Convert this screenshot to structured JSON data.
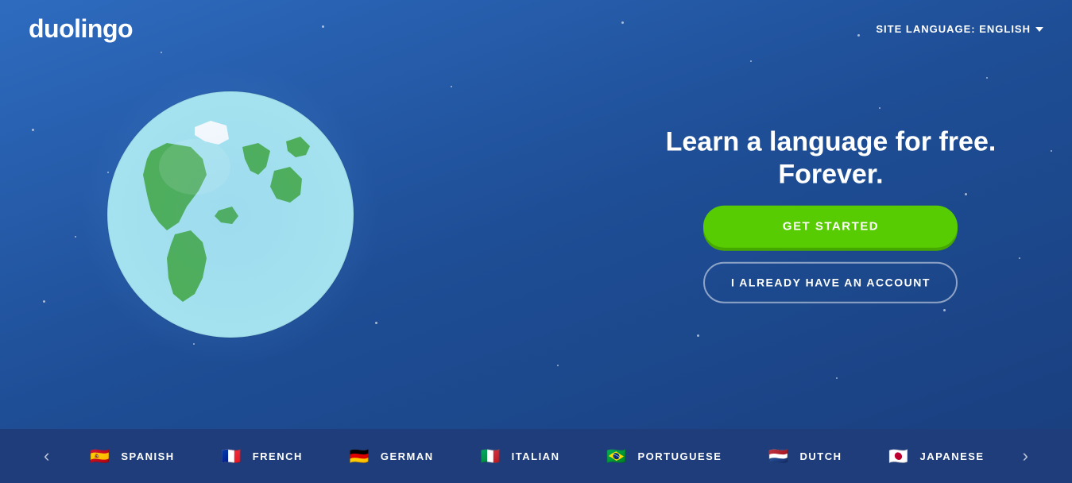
{
  "header": {
    "logo": "duolingo",
    "site_language_label": "SITE LANGUAGE: ENGLISH",
    "site_language_chevron": "▾"
  },
  "main": {
    "tagline": "Learn a language for free. Forever.",
    "get_started_label": "GET STARTED",
    "account_label": "I ALREADY HAVE AN ACCOUNT"
  },
  "bottom_bar": {
    "prev_label": "‹",
    "next_label": "›",
    "languages": [
      {
        "name": "SPANISH",
        "flag": "🇪🇸"
      },
      {
        "name": "FRENCH",
        "flag": "🇫🇷"
      },
      {
        "name": "GERMAN",
        "flag": "🇩🇪"
      },
      {
        "name": "ITALIAN",
        "flag": "🇮🇹"
      },
      {
        "name": "PORTUGUESE",
        "flag": "🇧🇷"
      },
      {
        "name": "DUTCH",
        "flag": "🇳🇱"
      },
      {
        "name": "JAPANESE",
        "flag": "🇯🇵"
      }
    ]
  },
  "colors": {
    "bg_main": "#2558a8",
    "bg_bottom": "#1e3d7a",
    "btn_green": "#58cc02",
    "btn_green_shadow": "#45a800"
  }
}
